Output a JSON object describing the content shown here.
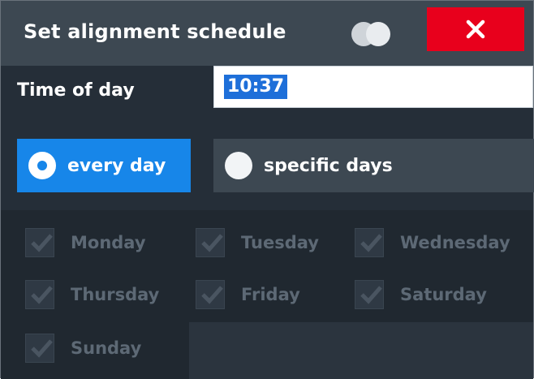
{
  "dialog": {
    "title": "Set alignment schedule",
    "close_icon": "close-icon",
    "toggle_icon": "toggle-icon"
  },
  "time": {
    "label": "Time of day",
    "value": "10:37"
  },
  "mode": {
    "every_day": "every day",
    "specific_days": "specific days",
    "selected": "every day"
  },
  "days": [
    {
      "label": "Monday",
      "checked": true
    },
    {
      "label": "Tuesday",
      "checked": true
    },
    {
      "label": "Wednesday",
      "checked": true
    },
    {
      "label": "Thursday",
      "checked": true
    },
    {
      "label": "Friday",
      "checked": true
    },
    {
      "label": "Saturday",
      "checked": true
    },
    {
      "label": "Sunday",
      "checked": true
    }
  ],
  "colors": {
    "accent": "#1786e9",
    "close": "#e8001c",
    "panel": "#252e38",
    "titlebar": "#3d4852"
  }
}
